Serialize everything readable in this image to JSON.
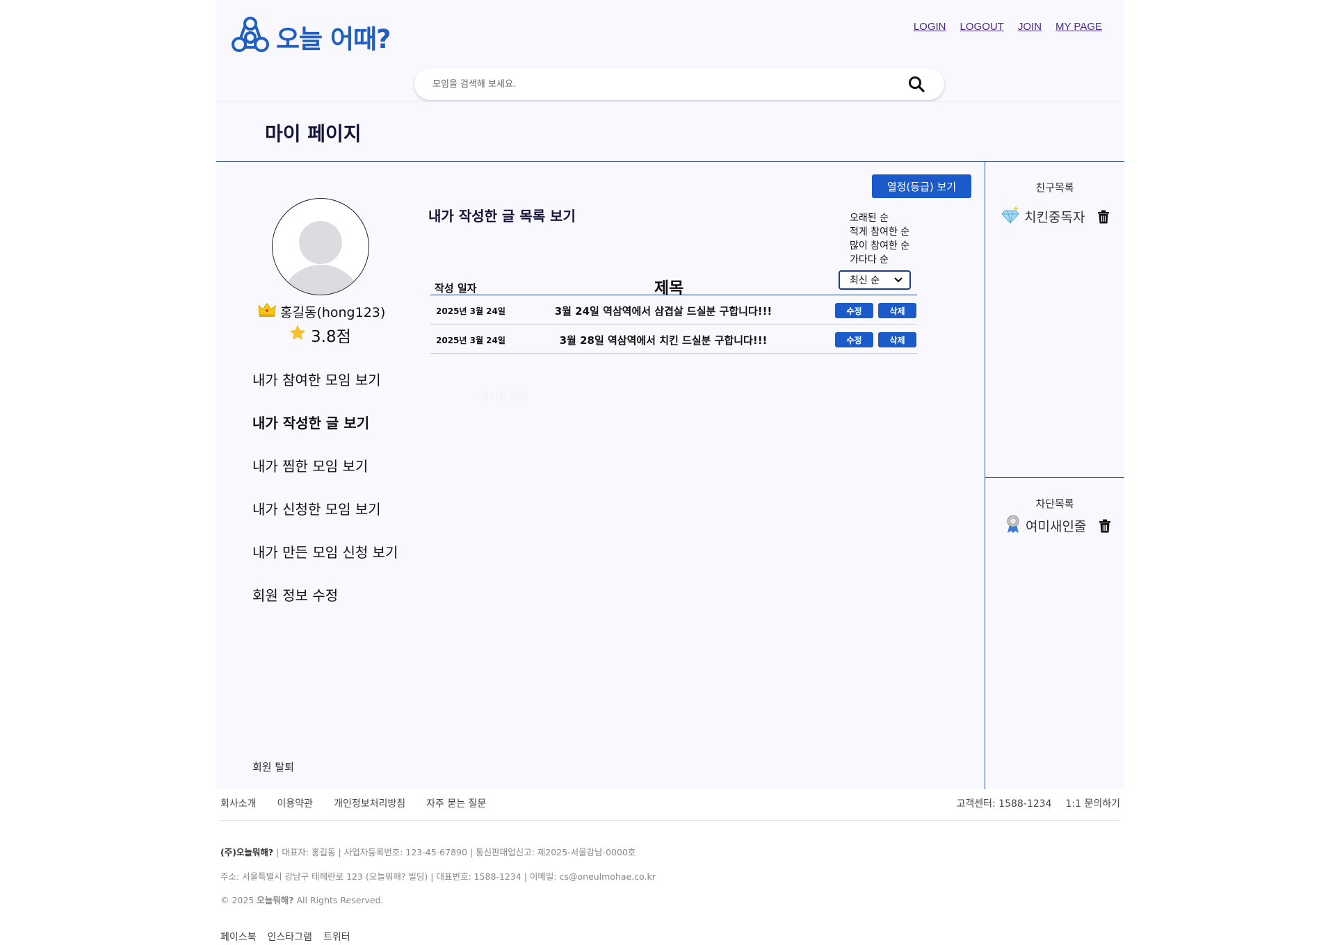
{
  "header": {
    "logo_text": "오늘 어때?",
    "nav": [
      "LOGIN",
      "LOGOUT",
      "JOIN",
      "MY PAGE"
    ],
    "search_placeholder": "모임을 검색해 보세요."
  },
  "page_title": "마이 페이지",
  "profile": {
    "name": "홍길동(hong123)",
    "score": "3.8점"
  },
  "menu": [
    "내가 참여한 모임 보기",
    "내가 작성한 글 보기",
    "내가 찜한 모임 보기",
    "내가 신청한 모임 보기",
    "내가 만든 모임 신청 보기",
    "회원 정보 수정"
  ],
  "withdraw_label": "회원 탈퇴",
  "grade_button": "열정(등급) 보기",
  "section_title": "내가 작성한 글 목록 보기",
  "sort_options": [
    "오래된 순",
    "적게 참여한 순",
    "많이 참여한 순",
    "가다다 순"
  ],
  "sort_selected": "최신 순",
  "table": {
    "col_date": "작성 일자",
    "col_title": "제목",
    "rows": [
      {
        "date": "2025년 3월 24일",
        "title": "3월 24일 역삼역에서 삼겹살 드실분 구합니다!!!"
      },
      {
        "date": "2025년 3월 24일",
        "title": "3월 28일 역삼역에서 치킨 드실분 구합니다!!!"
      }
    ],
    "edit_label": "수정",
    "delete_label": "삭제"
  },
  "faint_text": "이미지 변경",
  "friends": {
    "title": "친구목록",
    "items": [
      "치킨중독자"
    ]
  },
  "blocked": {
    "title": "차단목록",
    "items": [
      "여미새인줄"
    ]
  },
  "footer": {
    "links": [
      "회사소개",
      "이용약관",
      "개인정보처리방침",
      "자주 묻는 질문"
    ],
    "right": [
      "고객센터: 1588-1234",
      "1:1 문의하기"
    ],
    "company": "(주)오늘뭐해?",
    "info1": " | 대표자: 홍길동 | 사업자등록번호: 123-45-67890 | 통신판매업신고: 제2025-서울강남-0000호",
    "info2": "주소: 서울특별시 강남구 테헤란로 123 (오늘뭐해? 빌딩) | 대표번호: 1588-1234 | 이메일: cs@oneulmohae.co.kr",
    "copy_prefix": "© 2025 ",
    "copy_brand": "오늘뭐해?",
    "copy_suffix": " All Rights Reserved.",
    "social": [
      "페이스북",
      "인스타그램",
      "트위터"
    ]
  },
  "colors": {
    "brand": "#1f5fc4",
    "button": "#1a5bc9",
    "panel_bg": "#f8f8fe",
    "divider": "#3a5ea8"
  }
}
